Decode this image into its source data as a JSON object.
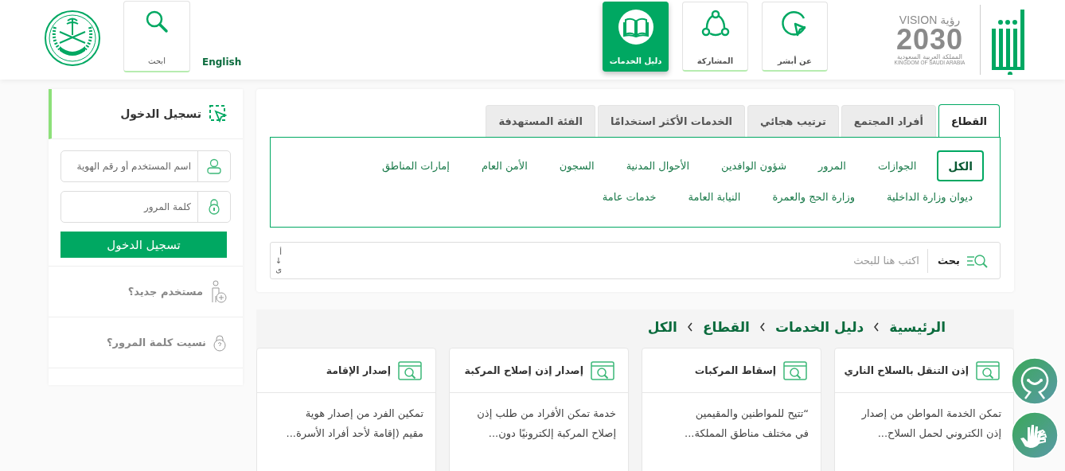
{
  "header": {
    "logo": {
      "vision": "VISION",
      "vision_ar": "رؤية",
      "year": "2030",
      "country_ar": "المملكة العربية السعودية",
      "country_en": "KINGDOM OF SAUDI ARABIA"
    },
    "nav": [
      {
        "label": "عن أبشر",
        "kind": "about",
        "selected": false
      },
      {
        "label": "المشاركة",
        "kind": "share",
        "selected": false
      },
      {
        "label": "دليل الخدمات",
        "kind": "guide",
        "selected": true
      }
    ],
    "language": "English",
    "search_button": "ابحث"
  },
  "login": {
    "title": "تسجيل الدخول",
    "username_placeholder": "اسم المستخدم أو رقم الهوية",
    "password_placeholder": "كلمة المرور",
    "submit": "تسجيل الدخول",
    "links": [
      {
        "label": "مستخدم جديد؟",
        "kind": "new-user"
      },
      {
        "label": "نسيت كلمة المرور؟",
        "kind": "forgot"
      }
    ]
  },
  "services": {
    "tabs": [
      {
        "label": "القطاع",
        "selected": true
      },
      {
        "label": "أفراد المجتمع",
        "selected": false
      },
      {
        "label": "ترتيب هجائي",
        "selected": false
      },
      {
        "label": "الخدمات الأكثر استخدامًا",
        "selected": false
      },
      {
        "label": "الفئة المستهدفة",
        "selected": false
      }
    ],
    "sectors": [
      {
        "label": "الكل",
        "selected": true
      },
      {
        "label": "الجوازات",
        "selected": false
      },
      {
        "label": "المرور",
        "selected": false
      },
      {
        "label": "شؤون الوافدين",
        "selected": false
      },
      {
        "label": "الأحوال المدنية",
        "selected": false
      },
      {
        "label": "السجون",
        "selected": false
      },
      {
        "label": "الأمن العام",
        "selected": false
      },
      {
        "label": "إمارات المناطق",
        "selected": false
      },
      {
        "label": "ديوان وزارة الداخلية",
        "selected": false
      },
      {
        "label": "وزارة الحج والعمرة",
        "selected": false
      },
      {
        "label": "النيابة العامة",
        "selected": false
      },
      {
        "label": "خدمات عامة",
        "selected": false
      }
    ],
    "search": {
      "label": "بحث",
      "placeholder": "اكتب هنا للبحث",
      "sort": [
        "أ",
        "↓",
        "ى"
      ]
    }
  },
  "breadcrumb": [
    "الرئيسية",
    "دليل الخدمات",
    "القطاع",
    "الكل"
  ],
  "cards": [
    {
      "title": "إذن التنقل بالسلاح الناري",
      "description_lines": [
        "تمكن الخدمة المواطن من إصدار",
        "إذن الكتروني لحمل السلاح..."
      ]
    },
    {
      "title": "إسقاط المركبات",
      "description_lines": [
        "“تتيح للمواطنين والمقيمين",
        "في مختلف مناطق المملكة..."
      ]
    },
    {
      "title": "إصدار إذن إصلاح المركبة",
      "description_lines": [
        "خدمة تمكن الأفراد من طلب إذن",
        "إصلاح المركبة إلكترونيًا دون..."
      ]
    },
    {
      "title": "إصدار الإقامة",
      "description_lines": [
        "تمكين الفرد من إصدار هوية",
        "مقيم (إقامة لأحد أفراد الأسرة..."
      ]
    }
  ],
  "floating_buttons": [
    {
      "kind": "support"
    },
    {
      "kind": "sign-language"
    }
  ]
}
